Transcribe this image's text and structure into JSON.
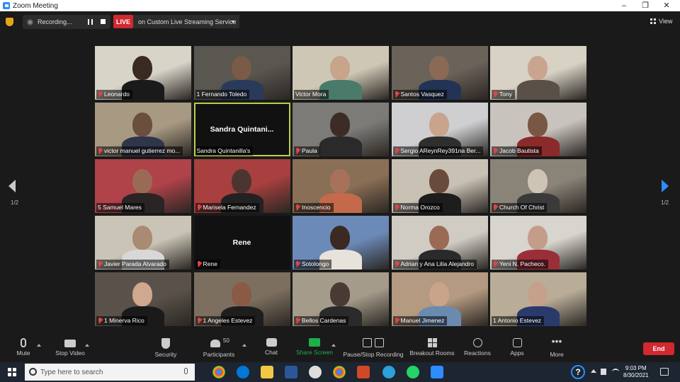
{
  "window": {
    "title": "Zoom Meeting",
    "minimize": "–",
    "restore": "❐",
    "close": "✕"
  },
  "topbar": {
    "recording_label": "Recording...",
    "live_badge": "LIVE",
    "live_service": "on Custom Live Streaming Service",
    "view_label": "View"
  },
  "pagination": {
    "left": "1/2",
    "right": "1/2"
  },
  "participants": [
    {
      "name": "Leonardo",
      "muted": true
    },
    {
      "name": "1 Fernando Toledo",
      "muted": false
    },
    {
      "name": "Victor Mora",
      "muted": false
    },
    {
      "name": "Santos Vasquez",
      "muted": true
    },
    {
      "name": "Tony",
      "muted": true
    },
    {
      "name": "victor manuel gutierrez mo...",
      "muted": true
    },
    {
      "name": "Sandra Quintanilla's",
      "muted": false,
      "card_text": "Sandra  Quintani..."
    },
    {
      "name": "Paula",
      "muted": true
    },
    {
      "name": "Sergio AReynRey391na Ber...",
      "muted": true
    },
    {
      "name": "Jacob Bautista",
      "muted": true
    },
    {
      "name": "5 Samuel Mares",
      "muted": false
    },
    {
      "name": "Marisela Fernandez",
      "muted": true
    },
    {
      "name": "Inoscencio",
      "muted": true
    },
    {
      "name": "Norma Orozco",
      "muted": true
    },
    {
      "name": "Church Of Christ",
      "muted": true
    },
    {
      "name": "Javier Parada Alvarado",
      "muted": true
    },
    {
      "name": "Rene",
      "muted": true,
      "card_text": "Rene"
    },
    {
      "name": "Sotolongo",
      "muted": true
    },
    {
      "name": "Adrian y Ana Lilia Alejandro",
      "muted": true
    },
    {
      "name": "Yeni N. Pacheco.",
      "muted": true
    },
    {
      "name": "1 Minerva Rico",
      "muted": true
    },
    {
      "name": "1 Angeles Estevez",
      "muted": true
    },
    {
      "name": "Bellos Cardenas",
      "muted": true
    },
    {
      "name": "Manuel  Jimenez",
      "muted": true
    },
    {
      "name": "1 Antonio Estevez",
      "muted": false
    }
  ],
  "toolbar": {
    "mute": "Mute",
    "stop_video": "Stop Video",
    "security": "Security",
    "participants": "Participants",
    "participants_count": "50",
    "chat": "Chat",
    "share_screen": "Share Screen",
    "pause_stop_recording": "Pause/Stop Recording",
    "breakout_rooms": "Breakout Rooms",
    "reactions": "Reactions",
    "apps": "Apps",
    "more": "More",
    "end": "End"
  },
  "taskbar": {
    "search_placeholder": "Type here to search",
    "time": "9:03 PM",
    "date": "8/30/2021",
    "help": "?"
  },
  "colors": {
    "accent": "#2d8cff",
    "live_red": "#d1292f",
    "active_speaker": "#b8d04a",
    "share_green": "#1fae49"
  }
}
